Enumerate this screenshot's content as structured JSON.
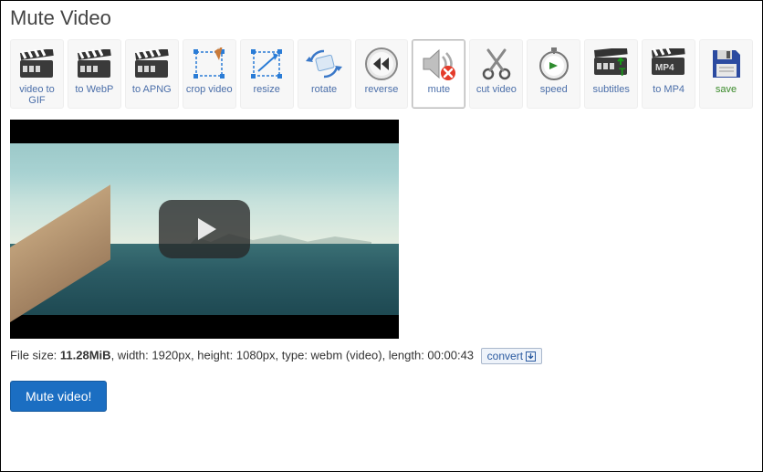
{
  "page": {
    "title": "Mute Video"
  },
  "toolbar": {
    "video_to_gif": "video to\nGIF",
    "to_webp": "to WebP",
    "to_apng": "to APNG",
    "crop_video": "crop video",
    "resize": "resize",
    "rotate": "rotate",
    "reverse": "reverse",
    "mute": "mute",
    "cut_video": "cut video",
    "speed": "speed",
    "subtitles": "subtitles",
    "to_mp4": "to MP4",
    "save": "save"
  },
  "video_info": {
    "prefix": "File size: ",
    "filesize": "11.28MiB",
    "rest": ", width: 1920px, height: 1080px, type: webm (video), length: 00:00:43",
    "convert": "convert"
  },
  "actions": {
    "mute_video": "Mute video!"
  }
}
